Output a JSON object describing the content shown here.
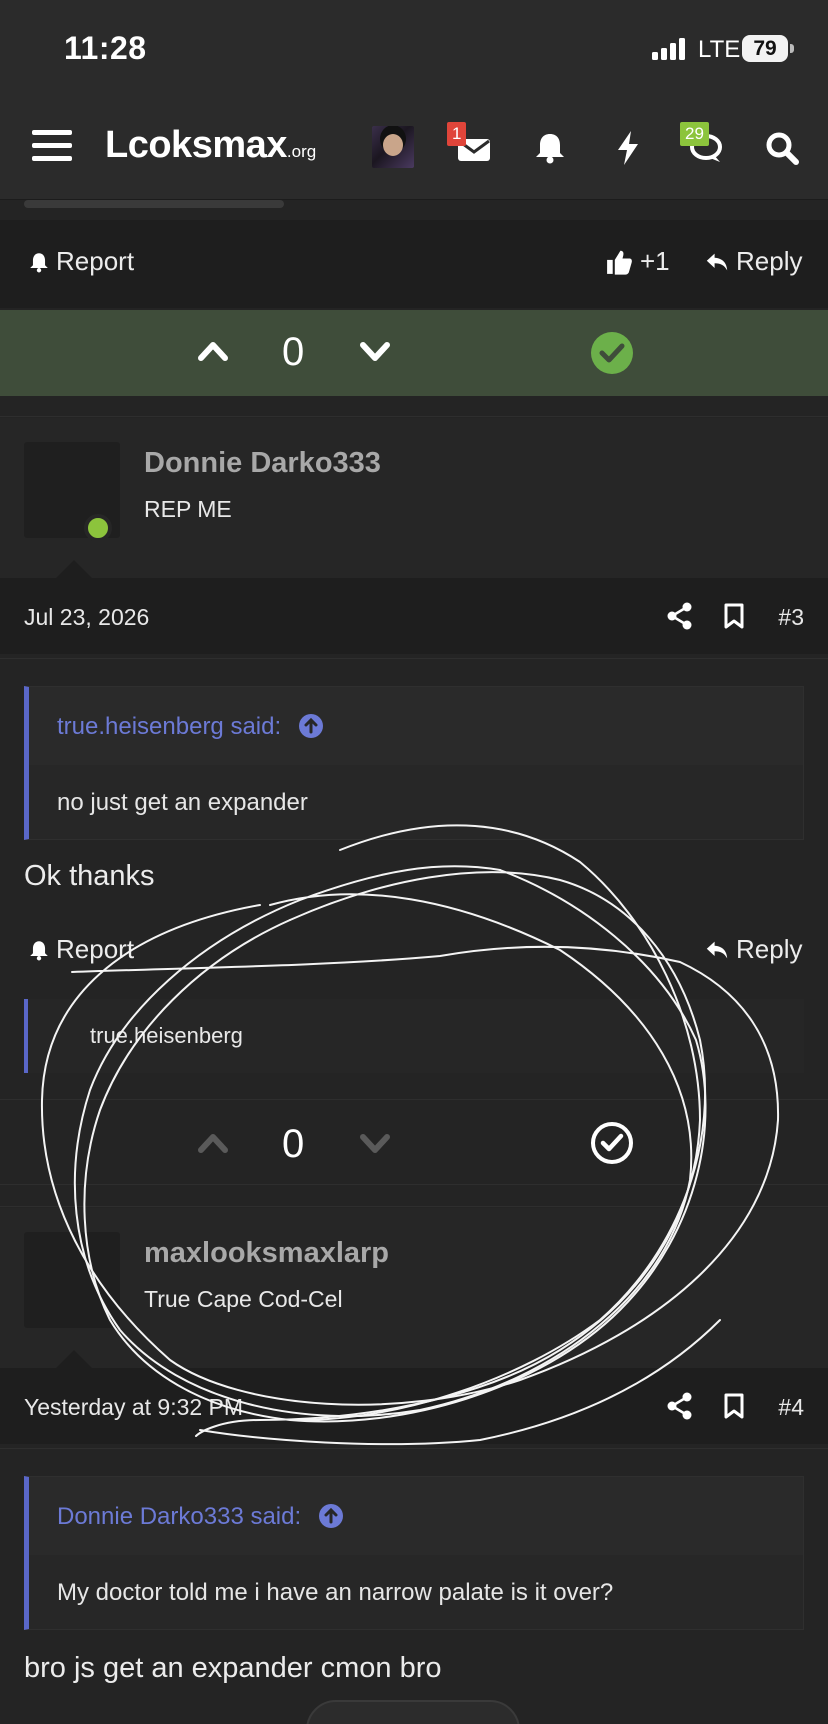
{
  "status_bar": {
    "time": "11:28",
    "network": "LTE",
    "battery": "79"
  },
  "header": {
    "logo_main": "Lcoksmax",
    "logo_tld": ".org",
    "inbox_badge": "1",
    "alerts_badge": "29",
    "badge_colors": {
      "inbox": "#e0453a",
      "alerts": "#8cc43c"
    }
  },
  "post2_actions": {
    "report": "Report",
    "like": "+1",
    "reply": "Reply",
    "vote_count": "0"
  },
  "post3": {
    "username": "Donnie Darko333",
    "user_title": "REP ME",
    "date": "Jul 23, 2026",
    "number": "#3",
    "quote_author": "true.heisenberg said:",
    "quote_text": "no just get an expander",
    "body": "Ok thanks",
    "report": "Report",
    "reply": "Reply",
    "signature": "true.heisenberg",
    "vote_count": "0"
  },
  "post4": {
    "username": "maxlooksmaxlarp",
    "user_title": "True Cape Cod-Cel",
    "date": "Yesterday at 9:32 PM",
    "number": "#4",
    "quote_author": "Donnie Darko333 said:",
    "quote_text": "My doctor told me i have an narrow palate is it over?",
    "body": "bro js get an expander cmon bro"
  },
  "colors": {
    "accepted_bar": "#3f4d3a",
    "accepted_check": "#6cb04a",
    "quote_border": "#5a67c8",
    "online": "#8cc43c"
  }
}
